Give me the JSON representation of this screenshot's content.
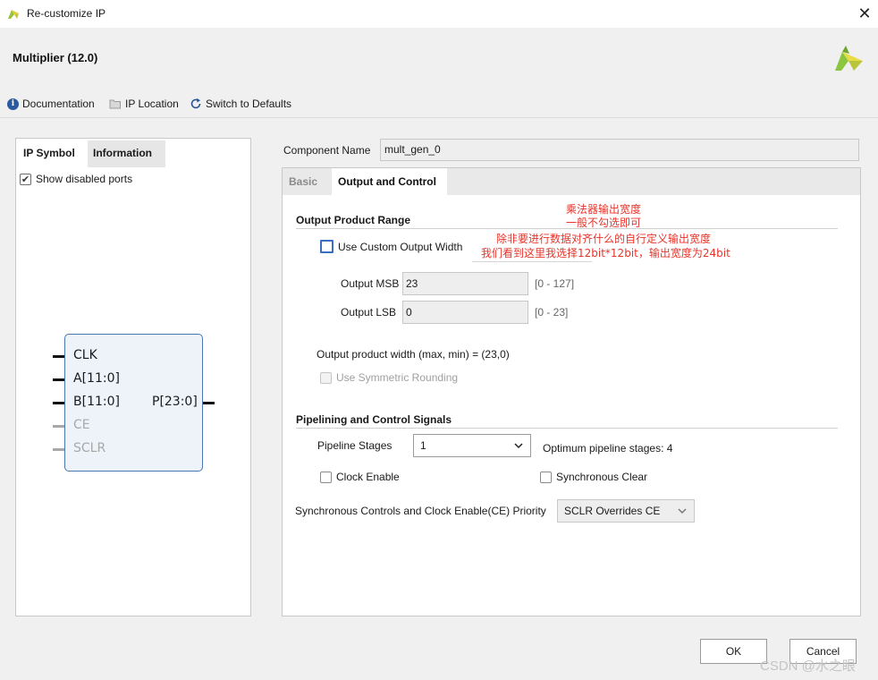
{
  "window": {
    "title": "Re-customize IP",
    "close_glyph": "✕"
  },
  "header": {
    "product_title": "Multiplier (12.0)",
    "toolbar": {
      "documentation": "Documentation",
      "ip_location": "IP Location",
      "switch_defaults": "Switch to Defaults"
    }
  },
  "left_panel": {
    "tabs": [
      "IP Symbol",
      "Information"
    ],
    "active_tab": "IP Symbol",
    "show_disabled_ports": {
      "label": "Show disabled ports",
      "checked": true
    },
    "symbol": {
      "inputs": [
        {
          "name": "CLK",
          "enabled": true
        },
        {
          "name": "A[11:0]",
          "enabled": true
        },
        {
          "name": "B[11:0]",
          "enabled": true
        },
        {
          "name": "CE",
          "enabled": false
        },
        {
          "name": "SCLR",
          "enabled": false
        }
      ],
      "outputs": [
        {
          "name": "P[23:0]",
          "enabled": true
        }
      ]
    }
  },
  "component": {
    "label": "Component Name",
    "value": "mult_gen_0"
  },
  "right_panel": {
    "tabs": [
      "Basic",
      "Output and Control"
    ],
    "active_tab": "Output and Control",
    "output_range": {
      "title": "Output Product Range",
      "use_custom_width": {
        "label": "Use Custom Output Width",
        "checked": false
      },
      "msb": {
        "label": "Output MSB",
        "value": "23",
        "range": "[0 - 127]"
      },
      "lsb": {
        "label": "Output LSB",
        "value": "0",
        "range": "[0 - 23]"
      },
      "width_text": "Output product width (max, min) = (23,0)",
      "symmetric_rounding": {
        "label": "Use Symmetric Rounding",
        "checked": false,
        "enabled": false
      }
    },
    "pipelining": {
      "title": "Pipelining and Control Signals",
      "stages_label": "Pipeline Stages",
      "stages_value": "1",
      "optimum_text": "Optimum pipeline stages: 4",
      "clock_enable": {
        "label": "Clock Enable",
        "checked": false
      },
      "sync_clear": {
        "label": "Synchronous Clear",
        "checked": false
      },
      "priority_label": "Synchronous Controls and Clock Enable(CE) Priority",
      "priority_value": "SCLR Overrides CE"
    }
  },
  "annotations": {
    "line1": "乘法器输出宽度",
    "line2": "一般不勾选即可",
    "line3": "除非要进行数据对齐什么的自行定义输出宽度",
    "line4": "我们看到这里我选择12bit*12bit，输出宽度为24bit",
    "color": "#e8342b"
  },
  "buttons": {
    "ok": "OK",
    "cancel": "Cancel"
  },
  "watermark": "CSDN @水之眼",
  "colors": {
    "accent_blue": "#3b6dc4",
    "logo_green": "#8cc63f",
    "logo_yellow": "#e5d33a"
  }
}
